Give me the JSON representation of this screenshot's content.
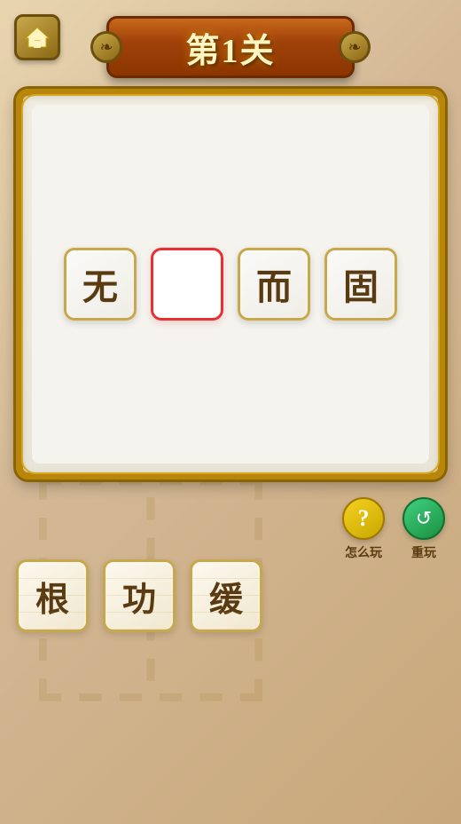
{
  "header": {
    "home_button_label": "🏠",
    "title": "第1关"
  },
  "board": {
    "tiles": [
      {
        "char": "无",
        "type": "filled"
      },
      {
        "char": "",
        "type": "empty"
      },
      {
        "char": "而",
        "type": "filled"
      },
      {
        "char": "固",
        "type": "filled"
      }
    ]
  },
  "controls": {
    "help_label": "怎么玩",
    "replay_label": "重玩"
  },
  "answer_tiles": [
    {
      "char": "根"
    },
    {
      "char": "功"
    },
    {
      "char": "缓"
    }
  ],
  "icons": {
    "home": "⌂",
    "help": "?",
    "replay": "↺"
  }
}
